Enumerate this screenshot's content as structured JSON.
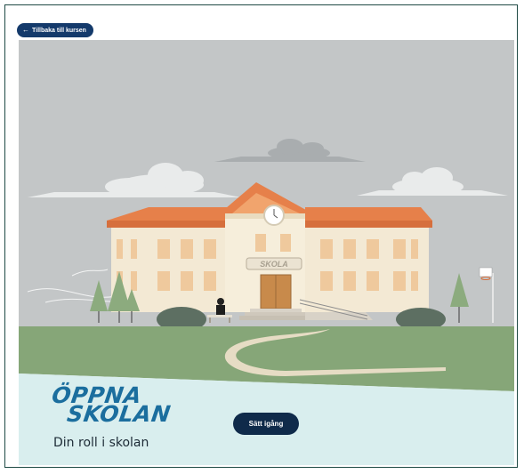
{
  "nav": {
    "back_label": "Tillbaka till kursen",
    "back_icon": "arrow-left-icon"
  },
  "hero": {
    "building_sign": "SKOLA",
    "brand_line1": "ÖPPNA",
    "brand_line2": "SKOLAN",
    "subtitle": "Din roll i skolan",
    "start_label": "Sätt igång"
  },
  "colors": {
    "sky": "#c3c6c7",
    "grass": "#86a678",
    "water": "#d9eeee",
    "roof": "#e6804a",
    "wall": "#f3e9d4",
    "window": "#efc99d",
    "brand": "#1b6e9e",
    "button": "#0f2a4a",
    "back_button": "#143a6b"
  }
}
